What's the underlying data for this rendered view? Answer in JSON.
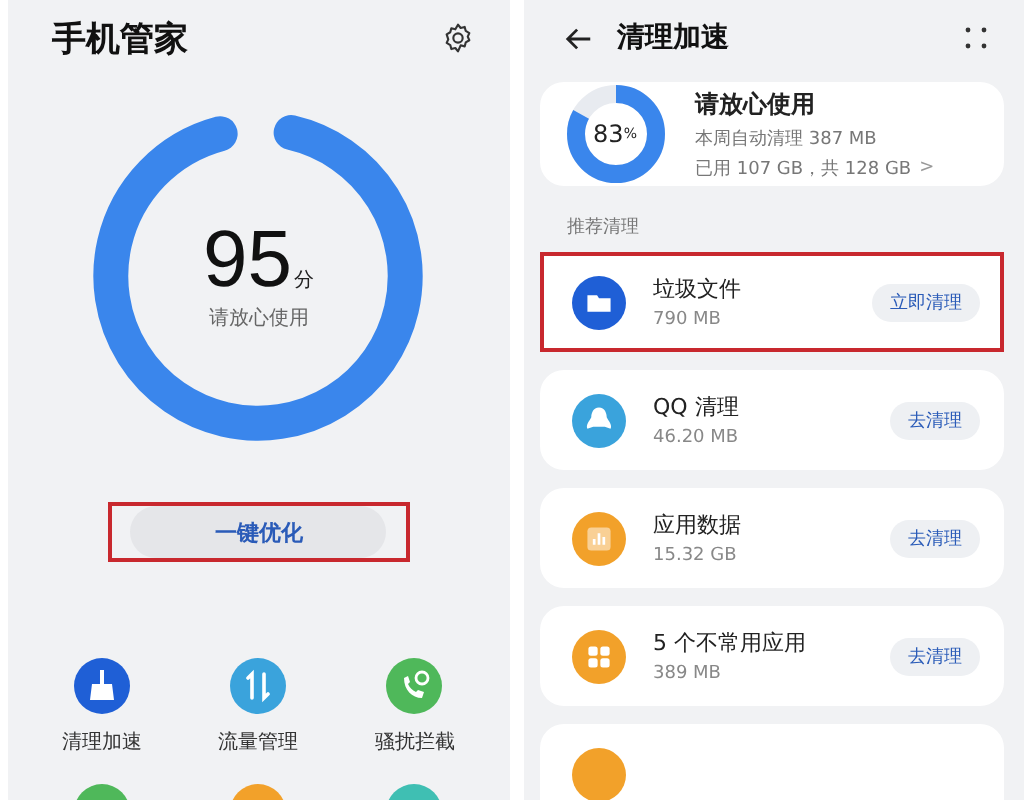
{
  "manager": {
    "title": "手机管家",
    "score": {
      "value": "95",
      "unit": "分",
      "status": "请放心使用",
      "level": 0.95
    },
    "optimize_button": {
      "label": "一键优化",
      "highlighted": true
    },
    "tools": [
      {
        "label": "清理加速",
        "color": "#1f5fd6",
        "kind": "broom"
      },
      {
        "label": "流量管理",
        "color": "#3aa3dc",
        "kind": "arrows"
      },
      {
        "label": "骚扰拦截",
        "color": "#4fb85a",
        "kind": "phone"
      },
      {
        "color": "#4fb85a",
        "kind": "blank"
      },
      {
        "color": "#f2a12a",
        "kind": "blank"
      },
      {
        "color": "#3fbfb3",
        "kind": "blank"
      }
    ]
  },
  "cleanup": {
    "title": "清理加速",
    "storage": {
      "percent": "83",
      "percent_unit": "%",
      "level": 0.83,
      "status": "请放心使用",
      "auto_cleaned": "本周自动清理 387 MB",
      "usage": "已用 107 GB，共 128 GB",
      "chevron": ">"
    },
    "section": "推荐清理",
    "items": [
      {
        "name": "垃圾文件",
        "size": "790 MB",
        "button": "立即清理",
        "color": "#1f5fd6",
        "kind": "folder",
        "highlighted": true
      },
      {
        "name": "QQ 清理",
        "size": "46.20 MB",
        "button": "去清理",
        "color": "#3aa3dc",
        "kind": "penguin",
        "highlighted": false
      },
      {
        "name": "应用数据",
        "size": "15.32 GB",
        "button": "去清理",
        "color": "#f2a12a",
        "kind": "chart",
        "highlighted": false
      },
      {
        "name": "5 个不常用应用",
        "size": "389 MB",
        "button": "去清理",
        "color": "#f2a12a",
        "kind": "apps",
        "highlighted": false
      },
      {
        "kind": "partial",
        "color": "#f2a12a",
        "highlighted": false
      }
    ]
  }
}
